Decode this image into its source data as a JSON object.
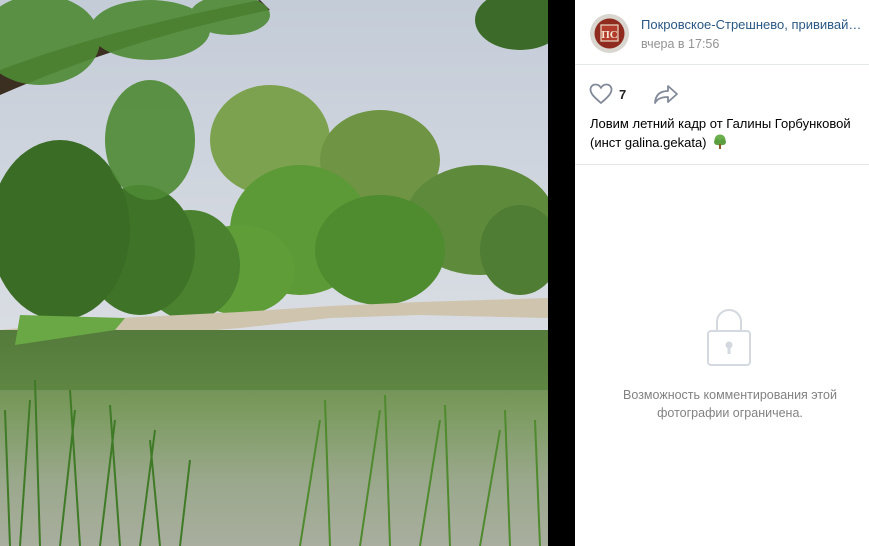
{
  "post": {
    "author_name": "Покровское-Стрешнево, прививай…",
    "date": "вчера в 17:56",
    "likes": "7",
    "caption": "Ловим летний кадр от Галины Горбунковой (инст galina.gekata)",
    "caption_emoji": "tree-emoji",
    "avatar_text": "ПС"
  },
  "comments": {
    "restricted_text": "Возможность комментирования этой фотографии ограничена."
  },
  "icons": {
    "like": "heart-icon",
    "share": "share-arrow-icon",
    "lock": "lock-icon"
  },
  "colors": {
    "link": "#2a5885",
    "muted": "#939393",
    "panel_bg": "#ffffff",
    "divider_bg": "#000000"
  }
}
